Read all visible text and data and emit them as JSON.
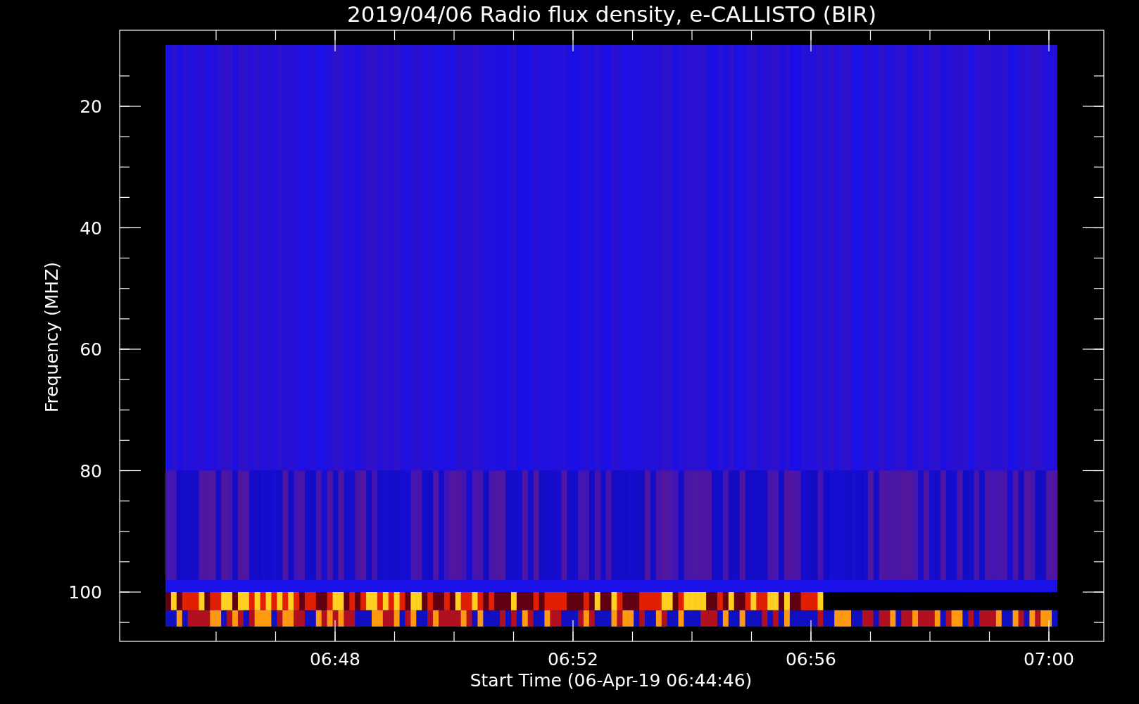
{
  "title": "2019/04/06  Radio flux density, e-CALLISTO (BIR)",
  "y_axis": {
    "label": "Frequency (MHZ)",
    "ticks": [
      "20",
      "40",
      "60",
      "80",
      "100"
    ]
  },
  "x_axis": {
    "label": "Start Time (06-Apr-19 06:44:46)",
    "ticks": [
      "06:48",
      "06:52",
      "06:56",
      "07:00"
    ]
  }
}
